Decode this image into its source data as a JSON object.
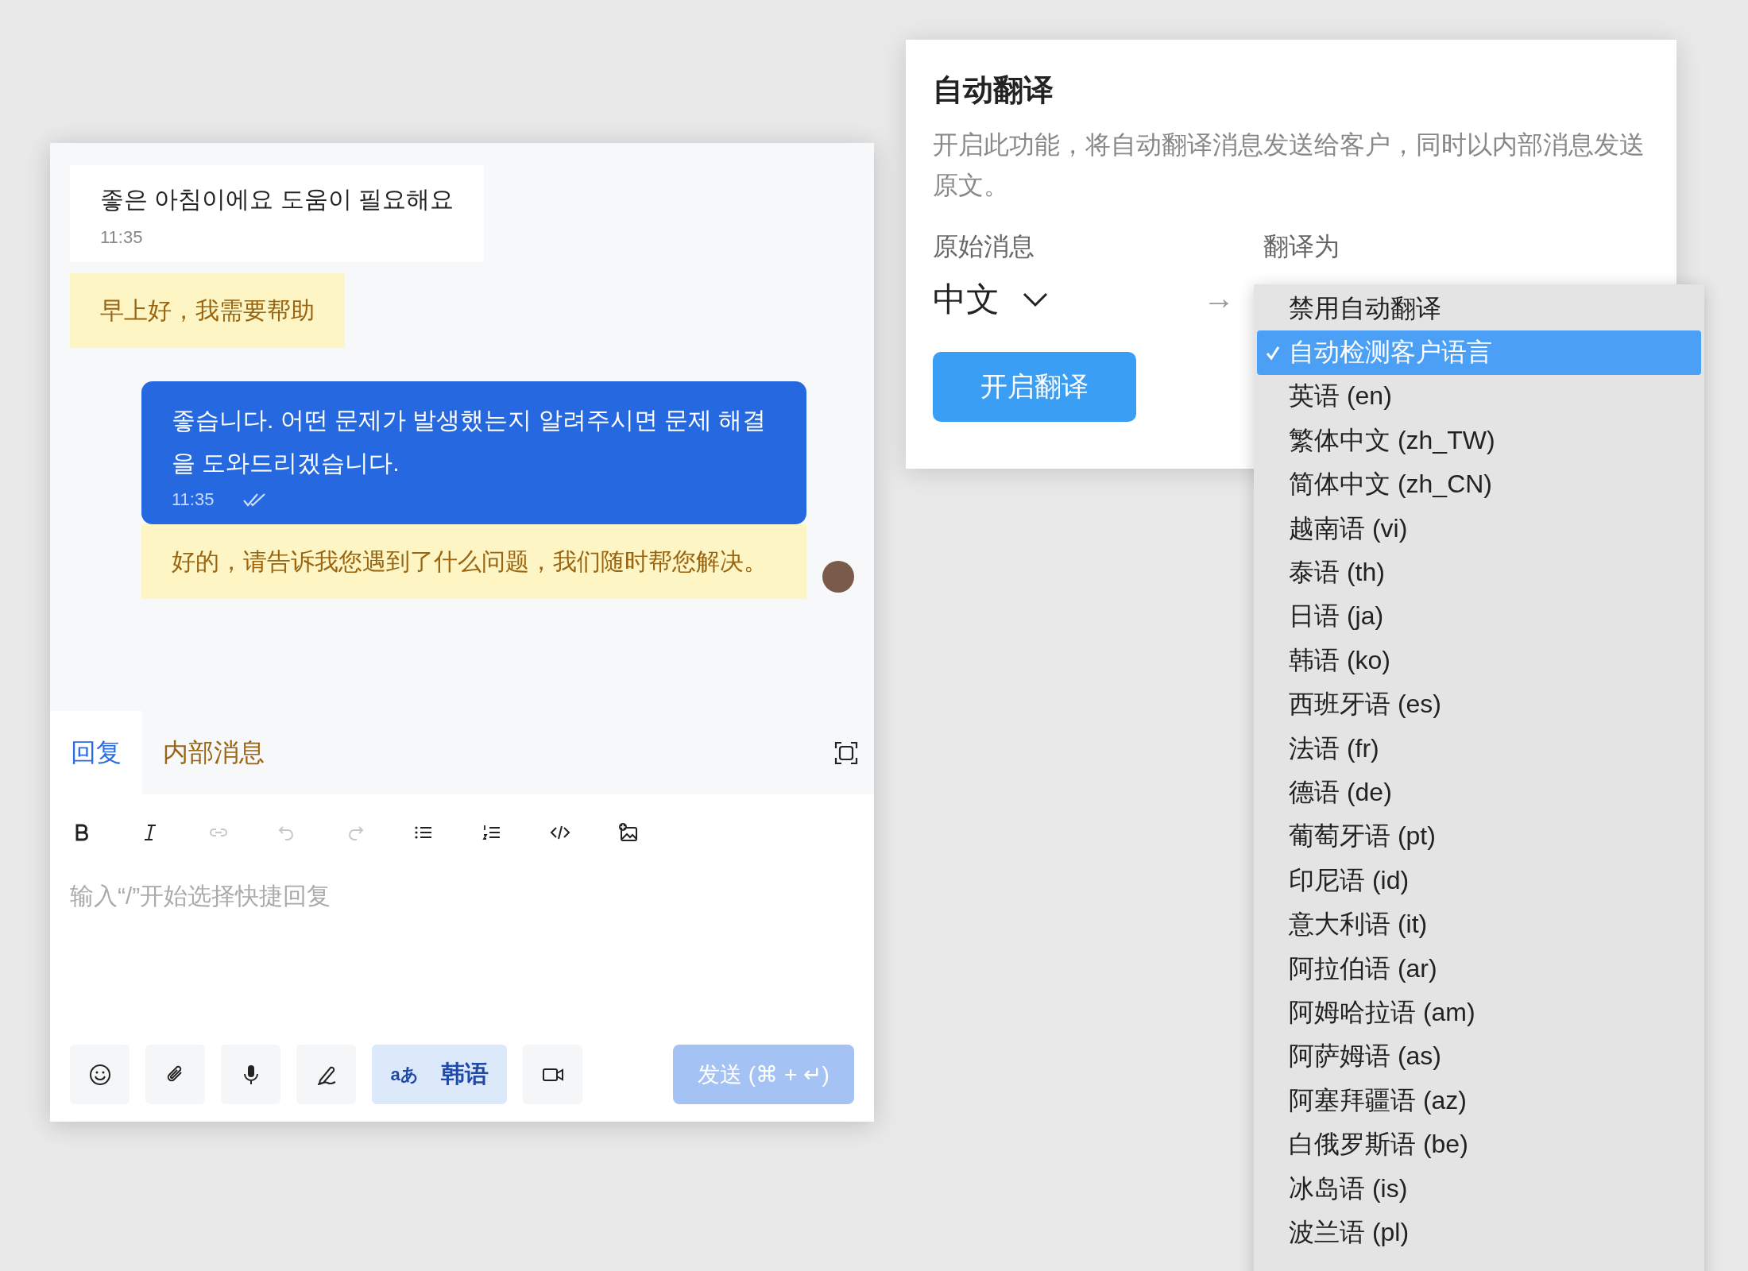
{
  "chat": {
    "messages": [
      {
        "kind": "incoming",
        "text": "좋은 아침이에요 도움이 필요해요",
        "time": "11:35"
      },
      {
        "kind": "translation",
        "text": "早上好，我需要帮助"
      },
      {
        "kind": "outgoing",
        "text": "좋습니다. 어떤 문제가 발생했는지 알려주시면 문제 해결을 도와드리겠습니다.",
        "time": "11:35",
        "read": true
      },
      {
        "kind": "translation",
        "text": "好的，请告诉我您遇到了什么问题，我们随时帮您解决。"
      }
    ]
  },
  "composer": {
    "tabs": [
      {
        "label": "回复",
        "selected": true
      },
      {
        "label": "内部消息",
        "selected": false
      }
    ],
    "toolbar": [
      {
        "kind": "bold",
        "disabled": false
      },
      {
        "kind": "italic",
        "disabled": false
      },
      {
        "kind": "link",
        "disabled": true
      },
      {
        "kind": "undo",
        "disabled": true
      },
      {
        "kind": "redo",
        "disabled": true
      },
      {
        "kind": "bullets",
        "disabled": false
      },
      {
        "kind": "numbers",
        "disabled": false
      },
      {
        "kind": "code",
        "disabled": false
      },
      {
        "kind": "image",
        "disabled": false
      }
    ],
    "placeholder": "输入“/”开始选择快捷回复",
    "translate_button": {
      "badge": "aあ",
      "label": "韩语"
    },
    "send_button": "发送 (⌘ + ↵)"
  },
  "translate_panel": {
    "title": "自动翻译",
    "description": "开启此功能，将自动翻译消息发送给客户，同时以内部消息发送原文。",
    "source_label": "原始消息",
    "source_value": "中文",
    "arrow": "→",
    "target_label": "翻译为",
    "button": "开启翻译"
  },
  "language_menu": {
    "options": [
      {
        "label": "禁用自动翻译",
        "selected": false
      },
      {
        "label": "自动检测客户语言",
        "selected": true
      },
      {
        "label": "英语 (en)",
        "selected": false
      },
      {
        "label": "繁体中文 (zh_TW)",
        "selected": false
      },
      {
        "label": "简体中文 (zh_CN)",
        "selected": false
      },
      {
        "label": "越南语 (vi)",
        "selected": false
      },
      {
        "label": "泰语 (th)",
        "selected": false
      },
      {
        "label": "日语 (ja)",
        "selected": false
      },
      {
        "label": "韩语 (ko)",
        "selected": false
      },
      {
        "label": "西班牙语 (es)",
        "selected": false
      },
      {
        "label": "法语 (fr)",
        "selected": false
      },
      {
        "label": "德语 (de)",
        "selected": false
      },
      {
        "label": "葡萄牙语 (pt)",
        "selected": false
      },
      {
        "label": "印尼语 (id)",
        "selected": false
      },
      {
        "label": "意大利语 (it)",
        "selected": false
      },
      {
        "label": "阿拉伯语 (ar)",
        "selected": false
      },
      {
        "label": "阿姆哈拉语 (am)",
        "selected": false
      },
      {
        "label": "阿萨姆语 (as)",
        "selected": false
      },
      {
        "label": "阿塞拜疆语 (az)",
        "selected": false
      },
      {
        "label": "白俄罗斯语 (be)",
        "selected": false
      },
      {
        "label": "冰岛语 (is)",
        "selected": false
      },
      {
        "label": "波兰语 (pl)",
        "selected": false
      }
    ]
  }
}
